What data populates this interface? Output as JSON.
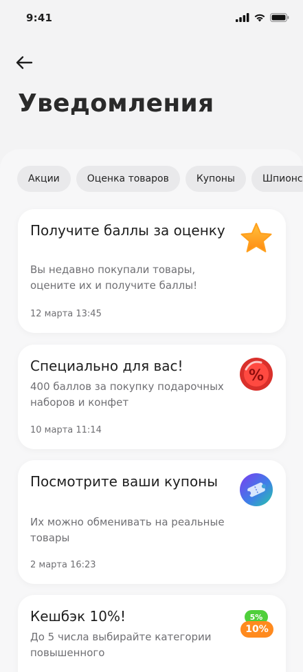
{
  "status_bar": {
    "time": "9:41",
    "icons": [
      "signal-icon",
      "wifi-icon",
      "battery-icon"
    ]
  },
  "header": {
    "back_icon": "back-arrow-icon",
    "title": "Уведомления"
  },
  "filters": [
    "Акции",
    "Оценка товаров",
    "Купоны",
    "Шпионс"
  ],
  "notifications": [
    {
      "title": "Получите баллы за оценку",
      "text": "Вы недавно покупали товары, оцените их и получите баллы!",
      "date": "12 марта 13:45",
      "icon": "star-icon"
    },
    {
      "title": "Специально для вас!",
      "text": "400 баллов за покупку подарочных наборов и конфет",
      "date": "10 марта 11:14",
      "icon": "percent-badge-icon"
    },
    {
      "title": "Посмотрите ваши купоны",
      "text": "Их можно обменивать на реальные товары",
      "date": "2 марта 16:23",
      "icon": "coupon-icon"
    },
    {
      "title": "Кешбэк 10%!",
      "text": "До 5 числа выбирайте категории повышенного",
      "icon": "cashback-icon",
      "badges": [
        "5%",
        "10%"
      ]
    }
  ],
  "colors": {
    "background": "#f3f3f4",
    "card": "#ffffff",
    "chip": "#e9e9eb",
    "text_secondary": "#6f6f73",
    "star": "#ff9f1c",
    "promo_red": "#d9302b",
    "cashback_green": "#4fcf3b",
    "cashback_orange": "#ff8a1e"
  }
}
